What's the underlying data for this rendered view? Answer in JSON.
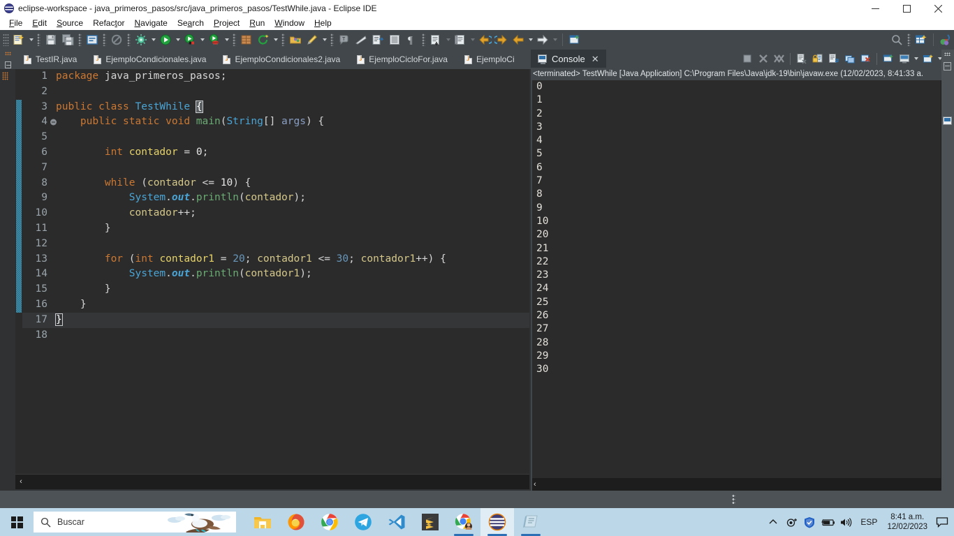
{
  "window": {
    "title": "eclipse-workspace - java_primeros_pasos/src/java_primeros_pasos/TestWhile.java - Eclipse IDE",
    "app_icon": "eclipse-icon",
    "minimize_label": "─",
    "maximize_label": "☐",
    "close_label": "✕"
  },
  "menubar": {
    "items": [
      {
        "label": "File",
        "mnemonic": "F"
      },
      {
        "label": "Edit",
        "mnemonic": "E"
      },
      {
        "label": "Source",
        "mnemonic": "S"
      },
      {
        "label": "Refactor",
        "mnemonic": "R"
      },
      {
        "label": "Navigate",
        "mnemonic": "N"
      },
      {
        "label": "Search",
        "mnemonic": "a"
      },
      {
        "label": "Project",
        "mnemonic": "P"
      },
      {
        "label": "Run",
        "mnemonic": "R"
      },
      {
        "label": "Window",
        "mnemonic": "W"
      },
      {
        "label": "Help",
        "mnemonic": "H"
      }
    ]
  },
  "toolbar": {
    "icons": [
      "new-wizard-icon",
      "save-icon",
      "save-all-icon",
      "toggle-comment-icon",
      "no-entry-icon",
      "external-tools-icon",
      "run-icon",
      "run-coverage-icon",
      "debug-icon",
      "new-package-icon",
      "refresh-icon",
      "open-task-icon",
      "pencil-icon",
      "search-reference-icon",
      "wedge-icon",
      "open-type-icon",
      "show-whitespace-icon",
      "pilcrow-icon",
      "next-annotation-icon",
      "previous-edit-icon",
      "back-icon",
      "forward-icon",
      "back-nav-icon",
      "forward-nav-icon",
      "new-window-icon",
      "java-perspective-icon",
      "search-icon"
    ]
  },
  "editor_tabs": {
    "items": [
      {
        "label": "TestIR.java",
        "active": false
      },
      {
        "label": "EjemploCondicionales.java",
        "active": false
      },
      {
        "label": "EjemploCondicionales2.java",
        "active": false
      },
      {
        "label": "EjemploCicloFor.java",
        "active": false
      },
      {
        "label": "EjemploCi",
        "active": false
      }
    ]
  },
  "editor": {
    "current_line": 17,
    "total_lines": 18,
    "fold_start_line": 3,
    "fold_end_line": 17,
    "collapse_marker_line": 4,
    "line_numbers": [
      "1",
      "2",
      "3",
      "4",
      "5",
      "6",
      "7",
      "8",
      "9",
      "10",
      "11",
      "12",
      "13",
      "14",
      "15",
      "16",
      "17",
      "18"
    ],
    "lines": [
      "package java_primeros_pasos;",
      "",
      "public class TestWhile {",
      "    public static void main(String[] args) {",
      "",
      "        int contador = 0;",
      "",
      "        while (contador <= 10) {",
      "            System.out.println(contador);",
      "            contador++;",
      "        }",
      "",
      "        for (int contador1 = 20; contador1 <= 30; contador1++) {",
      "            System.out.println(contador1);",
      "        }",
      "    }",
      "}",
      ""
    ],
    "scroll_left_arrow": "‹"
  },
  "console": {
    "tab_label": "Console",
    "tab_icon": "console-icon",
    "close_label": "✕",
    "status_line": "<terminated> TestWhile [Java Application] C:\\Program Files\\Java\\jdk-19\\bin\\javaw.exe  (12/02/2023, 8:41:33 a.",
    "tool_icons": [
      "terminate-icon",
      "remove-launch-icon",
      "remove-all-terminated-icon",
      "clear-console-icon",
      "scroll-lock-icon",
      "word-wrap-icon",
      "show-console-on-output-icon",
      "pin-console-icon",
      "display-selected-console-icon",
      "open-console-icon",
      "view-menu-icon",
      "minimize-icon"
    ],
    "output": [
      "0",
      "1",
      "2",
      "3",
      "4",
      "5",
      "6",
      "7",
      "8",
      "9",
      "10",
      "20",
      "21",
      "22",
      "23",
      "24",
      "25",
      "26",
      "27",
      "28",
      "29",
      "30"
    ],
    "scroll_up_arrow": "⌃",
    "scroll_down_arrow": "⌄",
    "hscroll_left_arrow": "‹",
    "hscroll_right_arrow": "›"
  },
  "taskbar": {
    "start_icon": "windows-logo-icon",
    "search": {
      "placeholder": "Buscar",
      "icon": "search-icon",
      "illustration": "blue-footed-booby-icon"
    },
    "apps": [
      {
        "name": "file-explorer",
        "active": false,
        "running": false
      },
      {
        "name": "firefox",
        "active": false,
        "running": false
      },
      {
        "name": "google-chrome",
        "active": false,
        "running": false
      },
      {
        "name": "telegram",
        "active": false,
        "running": false
      },
      {
        "name": "visual-studio-code",
        "active": false,
        "running": false
      },
      {
        "name": "sublime-text",
        "active": false,
        "running": false
      },
      {
        "name": "google-chrome-profile",
        "active": false,
        "running": true
      },
      {
        "name": "eclipse-ide",
        "active": true,
        "running": true
      },
      {
        "name": "notepad",
        "active": false,
        "running": true
      }
    ],
    "tray": {
      "icons": [
        "show-hidden-icons-chevron",
        "webcam-icon",
        "security-shield-icon",
        "battery-charging-icon",
        "volume-icon"
      ],
      "language": "ESP",
      "time": "8:41 a.m.",
      "date": "12/02/2023",
      "notification_icon": "notification-icon"
    }
  },
  "colors": {
    "titlebar_bg": "#ffffff",
    "toolbar_bg": "#41474b",
    "editor_bg": "#2b2b2b",
    "panel_bg": "#31373b",
    "fold_bar": "#20708f",
    "keyword": "#cc7832",
    "class_name": "#4aa5d6",
    "method": "#6aab73",
    "field": "#e6d36a",
    "number": "#6897bb",
    "taskbar_bg": "#bcd7e8",
    "accent_blue": "#2b6fb5"
  }
}
